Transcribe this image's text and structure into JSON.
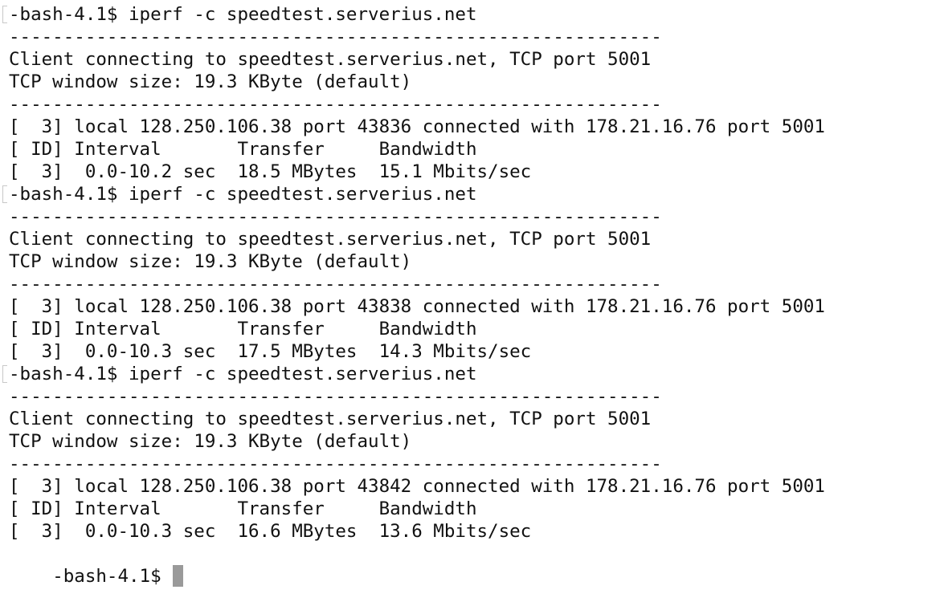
{
  "terminal": {
    "lines": [
      "-bash-4.1$ iperf -c speedtest.serverius.net",
      "------------------------------------------------------------",
      "Client connecting to speedtest.serverius.net, TCP port 5001",
      "TCP window size: 19.3 KByte (default)",
      "------------------------------------------------------------",
      "[  3] local 128.250.106.38 port 43836 connected with 178.21.16.76 port 5001",
      "[ ID] Interval       Transfer     Bandwidth",
      "[  3]  0.0-10.2 sec  18.5 MBytes  15.1 Mbits/sec",
      "-bash-4.1$ iperf -c speedtest.serverius.net",
      "------------------------------------------------------------",
      "Client connecting to speedtest.serverius.net, TCP port 5001",
      "TCP window size: 19.3 KByte (default)",
      "------------------------------------------------------------",
      "[  3] local 128.250.106.38 port 43838 connected with 178.21.16.76 port 5001",
      "[ ID] Interval       Transfer     Bandwidth",
      "[  3]  0.0-10.3 sec  17.5 MBytes  14.3 Mbits/sec",
      "-bash-4.1$ iperf -c speedtest.serverius.net",
      "------------------------------------------------------------",
      "Client connecting to speedtest.serverius.net, TCP port 5001",
      "TCP window size: 19.3 KByte (default)",
      "------------------------------------------------------------",
      "[  3] local 128.250.106.38 port 43842 connected with 178.21.16.76 port 5001",
      "[ ID] Interval       Transfer     Bandwidth",
      "[  3]  0.0-10.3 sec  16.6 MBytes  13.6 Mbits/sec"
    ],
    "prompt": "-bash-4.1$"
  },
  "colors": {
    "background": "#ffffff",
    "text": "#111111",
    "cursor": "#9a9a9a"
  }
}
